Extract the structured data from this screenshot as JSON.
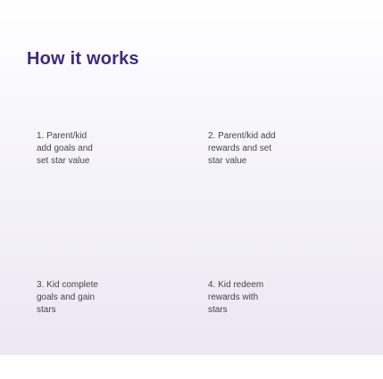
{
  "section": {
    "title": "How it works"
  },
  "steps": [
    {
      "lines": [
        "1. Parent/kid",
        "add goals and",
        "set star value"
      ]
    },
    {
      "lines": [
        "2. Parent/kid add",
        "rewards and set",
        "star value"
      ]
    },
    {
      "lines": [
        "3. Kid complete",
        "goals and gain",
        "stars"
      ]
    },
    {
      "lines": [
        "4. Kid redeem",
        "rewards with",
        "stars"
      ]
    }
  ]
}
